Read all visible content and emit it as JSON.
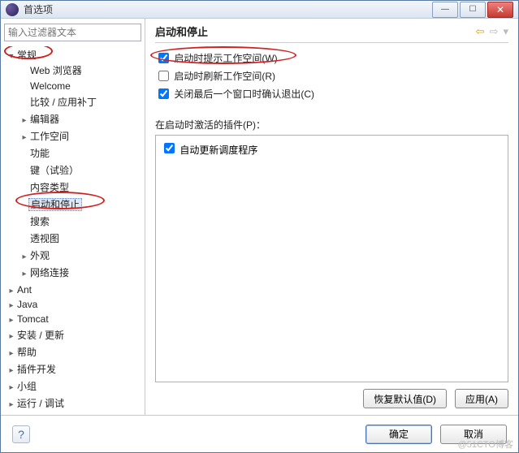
{
  "window": {
    "title": "首选项"
  },
  "sidebar": {
    "filter_placeholder": "输入过滤器文本",
    "items": {
      "general": "常规",
      "web_browser": "Web 浏览器",
      "welcome": "Welcome",
      "compare_patch": "比较 / 应用补丁",
      "editor": "编辑器",
      "workspace": "工作空间",
      "function": "功能",
      "keys": "键（试验）",
      "content_types": "内容类型",
      "startup_shutdown": "启动和停止",
      "search": "搜索",
      "perspectives": "透视图",
      "appearance": "外观",
      "network": "网络连接",
      "ant": "Ant",
      "java": "Java",
      "tomcat": "Tomcat",
      "install_update": "安装 / 更新",
      "help": "帮助",
      "plugin_dev": "插件开发",
      "team": "小组",
      "run_debug": "运行 / 调试"
    }
  },
  "page": {
    "title": "启动和停止",
    "check1": "启动时提示工作空间(W)",
    "check2": "启动时刷新工作空间(R)",
    "check3": "关闭最后一个窗口时确认退出(C)",
    "plugins_label": "在启动时激活的插件(P)：",
    "plugin1": "自动更新调度程序",
    "restore_defaults": "恢复默认值(D)",
    "apply": "应用(A)"
  },
  "footer": {
    "ok": "确定",
    "cancel": "取消"
  },
  "watermark": "@51CTO博客"
}
